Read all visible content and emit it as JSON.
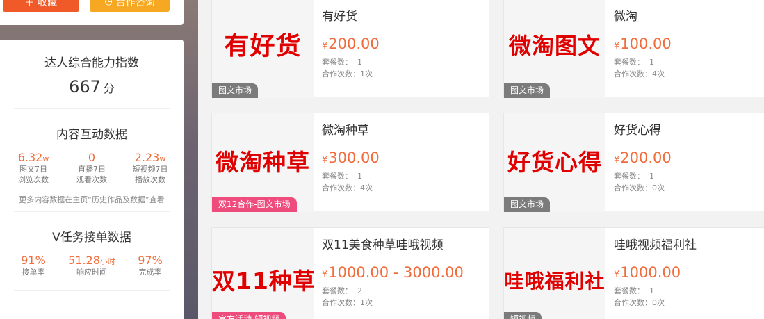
{
  "actions": {
    "favorite_label": "收藏",
    "favorite_icon": "plus-icon",
    "cooperate_label": "合作咨询",
    "cooperate_icon": "clock-icon"
  },
  "ability": {
    "title": "达人综合能力指数",
    "score": "667",
    "unit": "分"
  },
  "interaction": {
    "title": "内容互动数据",
    "metrics": [
      {
        "value": "6.32",
        "suffix": "w",
        "label1": "图文7日",
        "label2": "浏览次数"
      },
      {
        "value": "0",
        "suffix": "",
        "label1": "直播7日",
        "label2": "观看次数"
      },
      {
        "value": "2.23",
        "suffix": "w",
        "label1": "短视频7日",
        "label2": "播放次数"
      }
    ],
    "note": "更多内容数据在主页“历史作品及数据”查看"
  },
  "vtask": {
    "title": "V任务接单数据",
    "metrics": [
      {
        "value": "91%",
        "suffix": "",
        "label": "接单率"
      },
      {
        "value": "51.28",
        "suffix": "小时",
        "label": "响应时间"
      },
      {
        "value": "97%",
        "suffix": "",
        "label": "完成率"
      }
    ]
  },
  "currency": "¥",
  "package_label": "套餐数：",
  "coop_label": "合作次数：",
  "products": [
    {
      "thumb_text": "有好货",
      "tag": "图文市场",
      "title": "有好货",
      "price": "200.00",
      "packages": "1",
      "coop": "1次"
    },
    {
      "thumb_text": "微淘图文",
      "tag": "图文市场",
      "title": "微淘",
      "price": "100.00",
      "packages": "1",
      "coop": "4次"
    },
    {
      "thumb_text": "微淘种草",
      "tag": "双12合作-图文市场",
      "title": "微淘种草",
      "price": "300.00",
      "packages": "1",
      "coop": "4次"
    },
    {
      "thumb_text": "好货心得",
      "tag": "图文市场",
      "title": "好货心得",
      "price": "200.00",
      "packages": "1",
      "coop": "0次"
    },
    {
      "thumb_text": "双11种草",
      "tag": "官方活动-短视频",
      "title": "双11美食种草哇哦视频",
      "price": "1000.00 - 3000.00",
      "packages": "2",
      "coop": "1次"
    },
    {
      "thumb_text": "哇哦福利社",
      "tag": "短视频",
      "title": "哇哦视频福利社",
      "price": "1000.00",
      "packages": "1",
      "coop": "0次"
    }
  ]
}
